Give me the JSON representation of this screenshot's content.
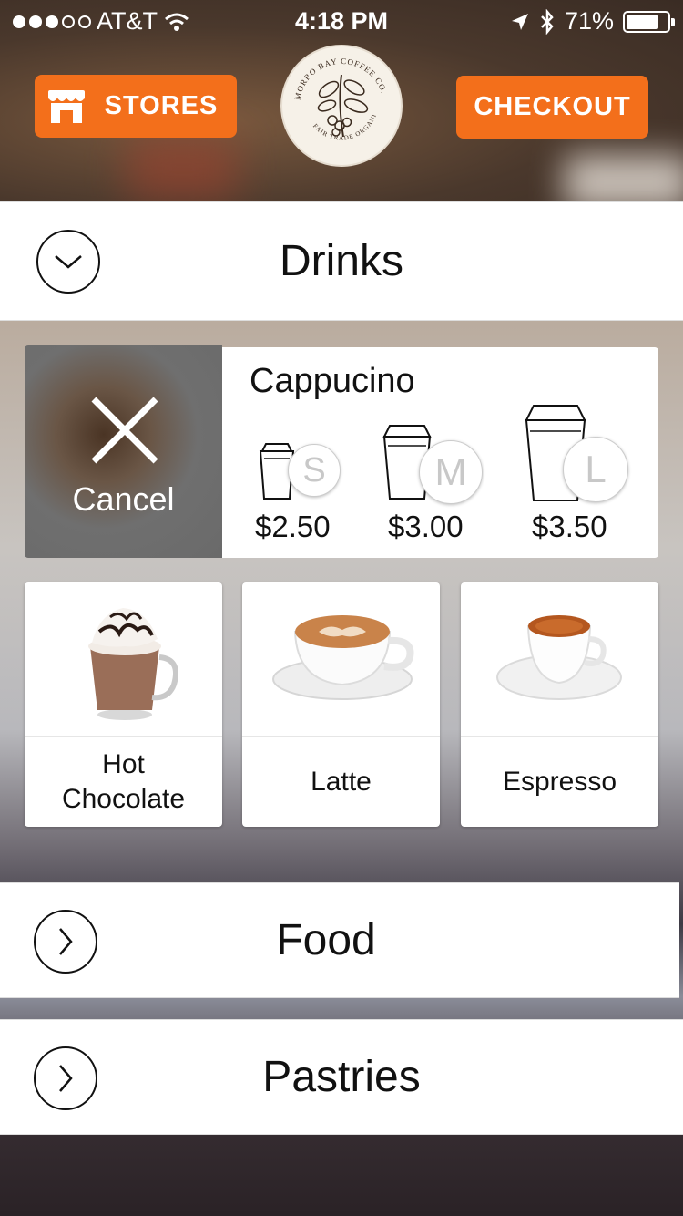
{
  "status_bar": {
    "carrier": "AT&T",
    "time": "4:18 PM",
    "battery": "71%"
  },
  "header": {
    "stores_label": "STORES",
    "checkout_label": "CHECKOUT",
    "accent_color": "#f36f1b",
    "logo_text": "MORRO BAY COFFEE CO.",
    "logo_subtext": "FAIR TRADE ORGANIC"
  },
  "sections": {
    "drinks": "Drinks",
    "food": "Food",
    "pastries": "Pastries"
  },
  "selection": {
    "cancel_label": "Cancel",
    "item_name": "Cappucino",
    "sizes": [
      {
        "letter": "S",
        "price": "$2.50"
      },
      {
        "letter": "M",
        "price": "$3.00"
      },
      {
        "letter": "L",
        "price": "$3.50"
      }
    ]
  },
  "products": [
    {
      "name": "Hot Chocolate",
      "line1": "Hot",
      "line2": "Chocolate"
    },
    {
      "name": "Latte"
    },
    {
      "name": "Espresso"
    }
  ]
}
